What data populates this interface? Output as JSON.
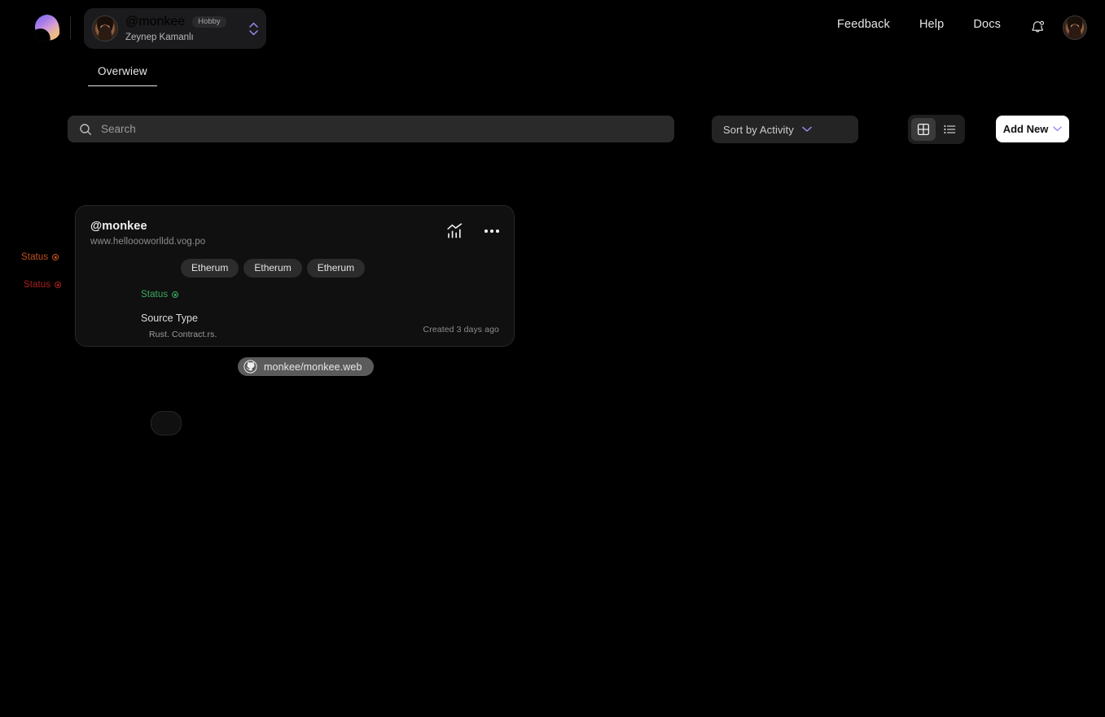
{
  "topbar": {
    "logo_name": "brand-logo",
    "account": {
      "handle": "@monkee",
      "plan_badge": "Hobby",
      "user_name": "Zeynep Kamanlı"
    },
    "nav_links": [
      {
        "label": "Feedback",
        "name": "feedback"
      },
      {
        "label": "Help",
        "name": "help"
      },
      {
        "label": "Docs",
        "name": "docs"
      }
    ],
    "notifications_icon": "bell-icon",
    "avatar_icon": "user-avatar"
  },
  "tabs": [
    {
      "label": "Overwiew",
      "active": true
    }
  ],
  "controls": {
    "search": {
      "placeholder": "Search",
      "value": "",
      "icon": "search-icon"
    },
    "sort": {
      "label": "Sort by Activity",
      "icon": "chevron-down-icon"
    },
    "view_toggle": {
      "grid_icon": "grid-view-icon",
      "list_icon": "list-view-icon",
      "active": "grid"
    },
    "add_new": {
      "label": "Add New",
      "icon": "chevron-down-icon"
    }
  },
  "margin_statuses": [
    {
      "label": "Status",
      "color": "#c2521f",
      "icon": "status-dot-icon"
    },
    {
      "label": "Status",
      "color": "#ab2020",
      "icon": "status-dot-icon"
    }
  ],
  "project_card": {
    "title": "@monkee",
    "url": "www.helloooworlldd.vog.po",
    "analytics_icon": "analytics-chart-icon",
    "more_icon": "more-horizontal-icon",
    "tags": [
      "Etherum",
      "Etherum",
      "Etherum"
    ],
    "status": {
      "label": "Status",
      "color": "#3bab63",
      "icon": "status-dot-icon"
    },
    "source_type_label": "Source Type",
    "source_type_value": "Rust. Contract.rs.",
    "created": "Created 3 days ago"
  },
  "repo_pill": {
    "icon": "github-icon",
    "label": "monkee/monkee.web"
  },
  "colors": {
    "background": "#000000",
    "card_bg": "#101010",
    "accent_purple": "#a78bfa",
    "status_green": "#3bab63",
    "status_orange": "#c2521f",
    "status_red": "#ab2020"
  }
}
